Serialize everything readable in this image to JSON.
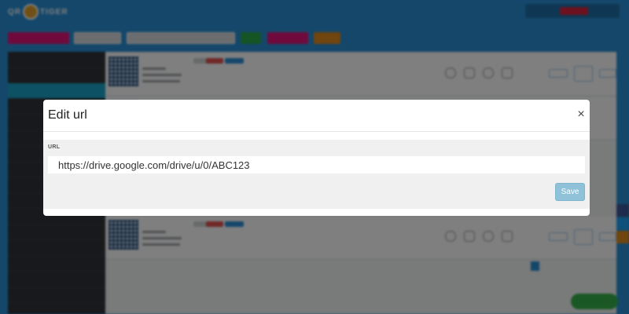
{
  "modal": {
    "title": "Edit url",
    "close_symbol": "×",
    "field_label": "URL",
    "url_value": "https://drive.google.com/drive/u/0/ABC123",
    "save_label": "Save"
  },
  "colors": {
    "brand_blue": "#2a8fd6",
    "sidebar_active": "#1aa2c9",
    "save_button": "#8fc2d8",
    "create_button": "#e0157a",
    "search_button": "#2aa84a",
    "export_button": "#e08a1c"
  },
  "icons": [
    "refresh-icon",
    "bell-icon",
    "info-icon",
    "lock-icon",
    "close-icon"
  ]
}
